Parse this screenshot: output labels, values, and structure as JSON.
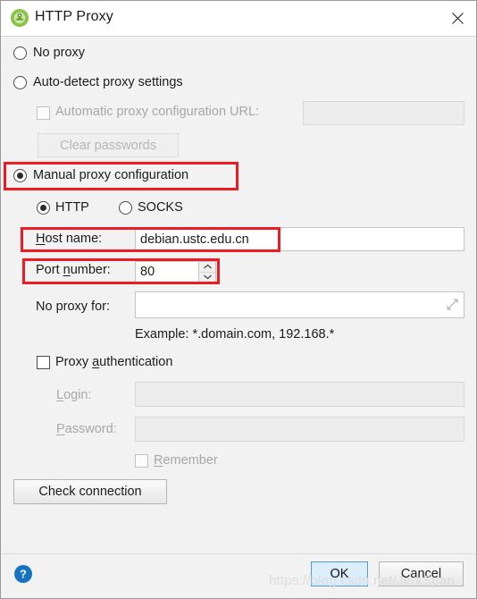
{
  "window": {
    "title": "HTTP Proxy",
    "app_icon": "android-studio-icon",
    "close_label": "✕"
  },
  "proxy_mode": {
    "no_proxy_label": "No proxy",
    "auto_detect_label": "Auto-detect proxy settings",
    "auto_config_url_label": "Automatic proxy configuration URL:",
    "auto_config_url_value": "",
    "clear_passwords_label": "Clear passwords",
    "manual_label": "Manual proxy configuration",
    "selected": "manual"
  },
  "protocol": {
    "http_label": "HTTP",
    "socks_label": "SOCKS",
    "selected": "HTTP"
  },
  "manual": {
    "host_name_label": "Host name:",
    "host_name_mnemonic": "H",
    "host_name_rest": "ost name:",
    "host_name_value": "debian.ustc.edu.cn",
    "port_label_pre": "Port ",
    "port_mnemonic": "n",
    "port_label_post": "umber:",
    "port_value": "80",
    "no_proxy_for_label": "No proxy for:",
    "no_proxy_for_value": "",
    "example_text": "Example: *.domain.com, 192.168.*"
  },
  "authentication": {
    "proxy_auth_pre": "Proxy ",
    "proxy_auth_mnemonic": "a",
    "proxy_auth_post": "uthentication",
    "checked": false,
    "login_mnemonic": "L",
    "login_rest": "ogin:",
    "login_value": "",
    "password_mnemonic": "P",
    "password_rest": "assword:",
    "password_value": "",
    "remember_mnemonic": "R",
    "remember_rest": "emember",
    "remember_checked": false
  },
  "actions": {
    "check_connection_label": "Check connection",
    "ok_label": "OK",
    "cancel_label": "Cancel",
    "help_label": "?"
  },
  "watermark": {
    "text": "https://blog.csdn.net/JerkSpan"
  },
  "colors": {
    "accent_red": "#ed1c24",
    "default_button_bg": "#dceefc",
    "default_button_border": "#4a9ede",
    "help_blue": "#1673c0",
    "dialog_bg": "#f2f2f2"
  }
}
